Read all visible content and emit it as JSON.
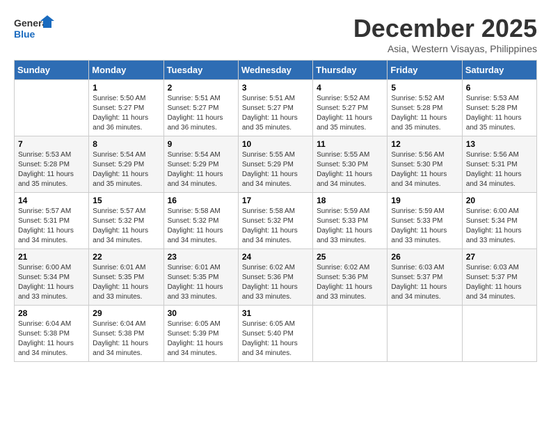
{
  "logo": {
    "line1": "General",
    "line2": "Blue"
  },
  "title": "December 2025",
  "subtitle": "Asia, Western Visayas, Philippines",
  "days_header": [
    "Sunday",
    "Monday",
    "Tuesday",
    "Wednesday",
    "Thursday",
    "Friday",
    "Saturday"
  ],
  "weeks": [
    [
      {
        "day": "",
        "info": ""
      },
      {
        "day": "1",
        "info": "Sunrise: 5:50 AM\nSunset: 5:27 PM\nDaylight: 11 hours and 36 minutes."
      },
      {
        "day": "2",
        "info": "Sunrise: 5:51 AM\nSunset: 5:27 PM\nDaylight: 11 hours and 36 minutes."
      },
      {
        "day": "3",
        "info": "Sunrise: 5:51 AM\nSunset: 5:27 PM\nDaylight: 11 hours and 35 minutes."
      },
      {
        "day": "4",
        "info": "Sunrise: 5:52 AM\nSunset: 5:27 PM\nDaylight: 11 hours and 35 minutes."
      },
      {
        "day": "5",
        "info": "Sunrise: 5:52 AM\nSunset: 5:28 PM\nDaylight: 11 hours and 35 minutes."
      },
      {
        "day": "6",
        "info": "Sunrise: 5:53 AM\nSunset: 5:28 PM\nDaylight: 11 hours and 35 minutes."
      }
    ],
    [
      {
        "day": "7",
        "info": "Sunrise: 5:53 AM\nSunset: 5:28 PM\nDaylight: 11 hours and 35 minutes."
      },
      {
        "day": "8",
        "info": "Sunrise: 5:54 AM\nSunset: 5:29 PM\nDaylight: 11 hours and 35 minutes."
      },
      {
        "day": "9",
        "info": "Sunrise: 5:54 AM\nSunset: 5:29 PM\nDaylight: 11 hours and 34 minutes."
      },
      {
        "day": "10",
        "info": "Sunrise: 5:55 AM\nSunset: 5:29 PM\nDaylight: 11 hours and 34 minutes."
      },
      {
        "day": "11",
        "info": "Sunrise: 5:55 AM\nSunset: 5:30 PM\nDaylight: 11 hours and 34 minutes."
      },
      {
        "day": "12",
        "info": "Sunrise: 5:56 AM\nSunset: 5:30 PM\nDaylight: 11 hours and 34 minutes."
      },
      {
        "day": "13",
        "info": "Sunrise: 5:56 AM\nSunset: 5:31 PM\nDaylight: 11 hours and 34 minutes."
      }
    ],
    [
      {
        "day": "14",
        "info": "Sunrise: 5:57 AM\nSunset: 5:31 PM\nDaylight: 11 hours and 34 minutes."
      },
      {
        "day": "15",
        "info": "Sunrise: 5:57 AM\nSunset: 5:32 PM\nDaylight: 11 hours and 34 minutes."
      },
      {
        "day": "16",
        "info": "Sunrise: 5:58 AM\nSunset: 5:32 PM\nDaylight: 11 hours and 34 minutes."
      },
      {
        "day": "17",
        "info": "Sunrise: 5:58 AM\nSunset: 5:32 PM\nDaylight: 11 hours and 34 minutes."
      },
      {
        "day": "18",
        "info": "Sunrise: 5:59 AM\nSunset: 5:33 PM\nDaylight: 11 hours and 33 minutes."
      },
      {
        "day": "19",
        "info": "Sunrise: 5:59 AM\nSunset: 5:33 PM\nDaylight: 11 hours and 33 minutes."
      },
      {
        "day": "20",
        "info": "Sunrise: 6:00 AM\nSunset: 5:34 PM\nDaylight: 11 hours and 33 minutes."
      }
    ],
    [
      {
        "day": "21",
        "info": "Sunrise: 6:00 AM\nSunset: 5:34 PM\nDaylight: 11 hours and 33 minutes."
      },
      {
        "day": "22",
        "info": "Sunrise: 6:01 AM\nSunset: 5:35 PM\nDaylight: 11 hours and 33 minutes."
      },
      {
        "day": "23",
        "info": "Sunrise: 6:01 AM\nSunset: 5:35 PM\nDaylight: 11 hours and 33 minutes."
      },
      {
        "day": "24",
        "info": "Sunrise: 6:02 AM\nSunset: 5:36 PM\nDaylight: 11 hours and 33 minutes."
      },
      {
        "day": "25",
        "info": "Sunrise: 6:02 AM\nSunset: 5:36 PM\nDaylight: 11 hours and 33 minutes."
      },
      {
        "day": "26",
        "info": "Sunrise: 6:03 AM\nSunset: 5:37 PM\nDaylight: 11 hours and 34 minutes."
      },
      {
        "day": "27",
        "info": "Sunrise: 6:03 AM\nSunset: 5:37 PM\nDaylight: 11 hours and 34 minutes."
      }
    ],
    [
      {
        "day": "28",
        "info": "Sunrise: 6:04 AM\nSunset: 5:38 PM\nDaylight: 11 hours and 34 minutes."
      },
      {
        "day": "29",
        "info": "Sunrise: 6:04 AM\nSunset: 5:38 PM\nDaylight: 11 hours and 34 minutes."
      },
      {
        "day": "30",
        "info": "Sunrise: 6:05 AM\nSunset: 5:39 PM\nDaylight: 11 hours and 34 minutes."
      },
      {
        "day": "31",
        "info": "Sunrise: 6:05 AM\nSunset: 5:40 PM\nDaylight: 11 hours and 34 minutes."
      },
      {
        "day": "",
        "info": ""
      },
      {
        "day": "",
        "info": ""
      },
      {
        "day": "",
        "info": ""
      }
    ]
  ]
}
